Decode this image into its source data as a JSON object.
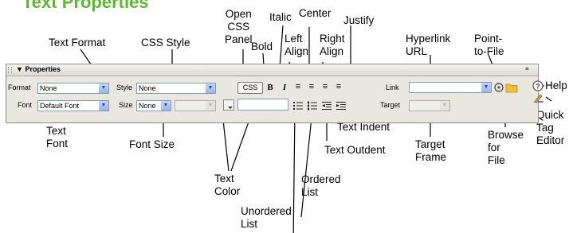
{
  "title": "Text Properties",
  "panel": {
    "title": "Properties",
    "format_label": "Format",
    "format_value": "None",
    "style_label": "Style",
    "style_value": "None",
    "css_button": "CSS",
    "bold": "B",
    "italic": "I",
    "link_label": "Link",
    "link_value": "",
    "font_label": "Font",
    "font_value": "Default Font",
    "size_label": "Size",
    "size_value": "None",
    "target_label": "Target",
    "target_value": ""
  },
  "callouts": {
    "text_format": "Text Format",
    "css_style": "CSS Style",
    "open_css_panel": "Open\nCSS\nPanel",
    "bold": "Bold",
    "italic": "Italic",
    "left_align": "Left\nAlign",
    "center": "Center",
    "right_align": "Right\nAlign",
    "justify": "Justify",
    "hyperlink_url": "Hyperlink\nURL",
    "point_to_file": "Point-\nto-File",
    "help": "Help",
    "quick_tag_editor": "Quick\nTag\nEditor",
    "browse_for_file": "Browse\nfor\nFile",
    "target_frame": "Target\nFrame",
    "text_indent": "Text Indent",
    "text_outdent": "Text Outdent",
    "ordered_list": "Ordered\nList",
    "unordered_list": "Unordered\nList",
    "text_color": "Text\nColor",
    "font_size": "Font Size",
    "text_font": "Text\nFont"
  },
  "icons": {
    "collapse": "triangle-down-icon",
    "panel_menu": "list-menu-icon",
    "align_left": "align-left-icon",
    "align_center": "align-center-icon",
    "align_right": "align-right-icon",
    "justify": "justify-icon",
    "unordered_list": "bullet-list-icon",
    "ordered_list": "numbered-list-icon",
    "outdent": "outdent-icon",
    "indent": "indent-icon",
    "point_to_file": "point-to-file-icon",
    "browse": "folder-icon",
    "help": "help-icon",
    "quick_tag": "quick-tag-editor-icon"
  },
  "colors": {
    "title": "#5cb82c",
    "panel": "#e8e8e1",
    "field_border": "#7f9db9"
  }
}
